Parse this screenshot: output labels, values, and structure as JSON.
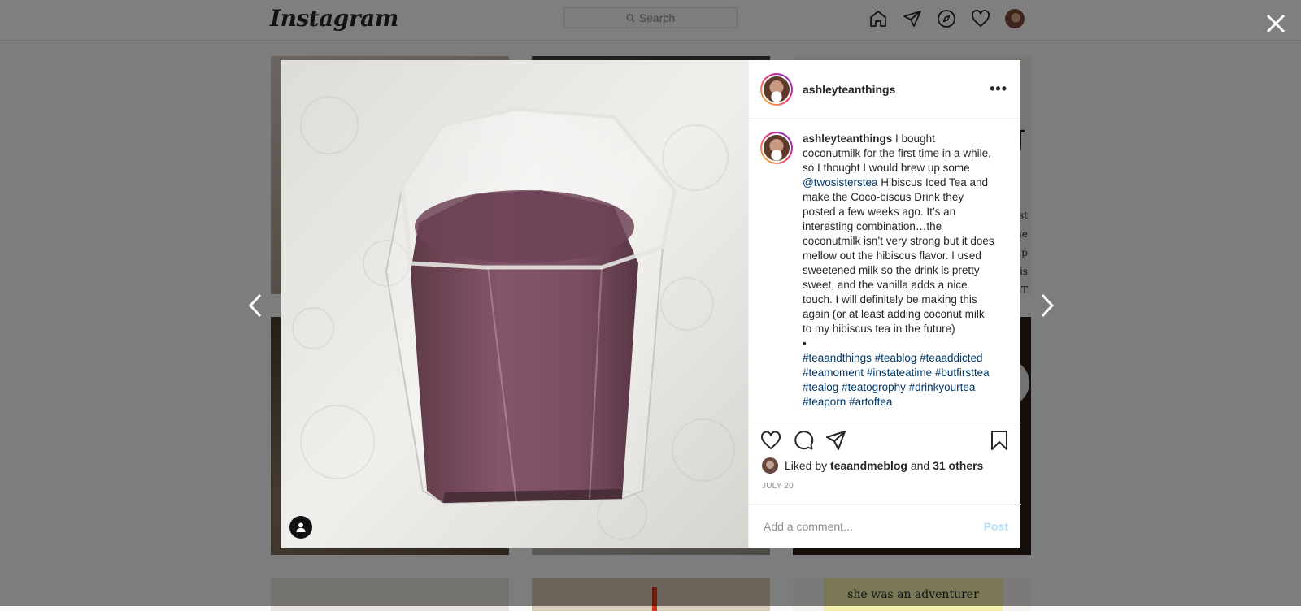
{
  "app": {
    "logo_text": "Instagram"
  },
  "search": {
    "placeholder": "Search"
  },
  "nav": {
    "icons": [
      "home-icon",
      "direct-icon",
      "explore-icon",
      "activity-heart-icon",
      "profile-avatar"
    ]
  },
  "background_grid": {
    "quote_text": "she was an adventurer"
  },
  "modal": {
    "username": "ashleyteanthings",
    "more_label": "•••",
    "caption": {
      "username": "ashleyteanthings",
      "text_before_mention": " I bought coconutmilk for the first time in a while, so I thought I would brew up some ",
      "mention": "@twosisterstea",
      "text_after_mention": " Hibiscus Iced Tea and make the Coco-biscus Drink they posted a few weeks ago. It’s an interesting combination…the coconutmilk isn’t very strong but it does mellow out the hibiscus flavor. I used sweetened milk so the drink is pretty sweet, and the vanilla adds a nice touch. I will definitely be making this again (or at least adding coconut milk to my hibiscus tea in the future)",
      "bullet": "•",
      "hashtags": [
        "#teaandthings",
        "#teablog",
        "#teaaddicted",
        "#teamoment",
        "#instateatime",
        "#butfirsttea",
        "#tealog",
        "#teatogrophy",
        "#drinkyourtea",
        "#teaporn",
        "#artoftea"
      ]
    },
    "likes": {
      "prefix": "Liked by ",
      "user": "teaandmeblog",
      "middle": " and ",
      "others": "31 others"
    },
    "date": "JULY 20",
    "comment": {
      "placeholder": "Add a comment...",
      "post_label": "Post"
    }
  },
  "icons": {
    "close": "close-icon",
    "prev": "chevron-left-icon",
    "next": "chevron-right-icon",
    "like": "heart-icon",
    "comment": "comment-icon",
    "share": "share-icon",
    "save": "bookmark-icon",
    "user_tag": "user-tag-icon"
  }
}
